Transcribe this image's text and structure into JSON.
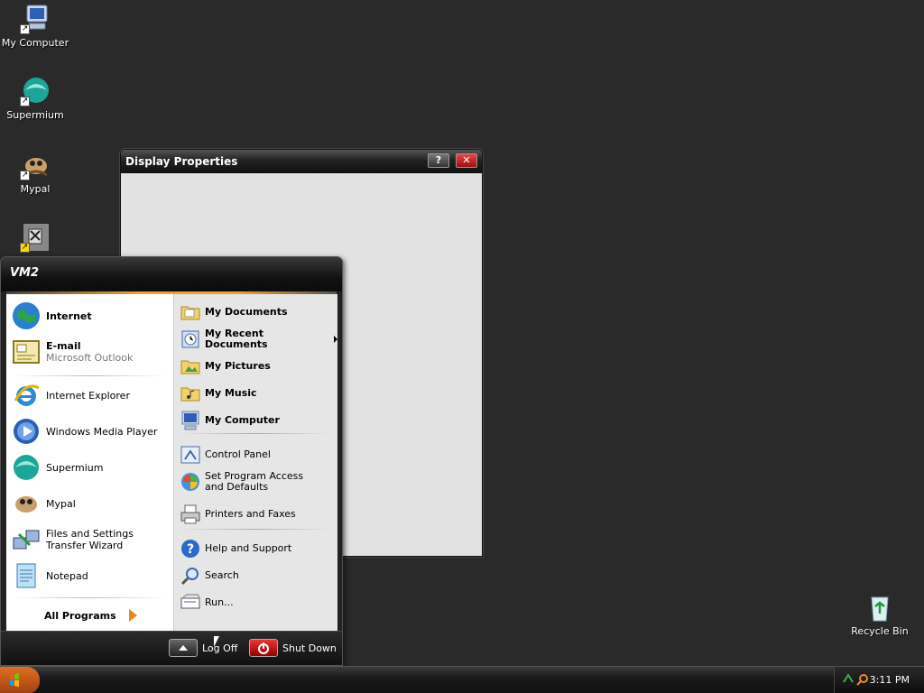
{
  "desktop": {
    "icons": [
      {
        "label": "My Computer"
      },
      {
        "label": "Supermium"
      },
      {
        "label": "Mypal"
      },
      {
        "label": ""
      },
      {
        "label": "Recycle Bin"
      }
    ]
  },
  "window": {
    "title": "Display Properties",
    "help_label": "?",
    "close_label": "✕"
  },
  "start_menu": {
    "user": "VM2",
    "pinned": [
      {
        "title": "Internet",
        "subtitle": ""
      },
      {
        "title": "E-mail",
        "subtitle": "Microsoft Outlook"
      }
    ],
    "recent": [
      {
        "label": "Internet Explorer"
      },
      {
        "label": "Windows Media Player"
      },
      {
        "label": "Supermium"
      },
      {
        "label": "Mypal"
      },
      {
        "label": "Files and Settings Transfer Wizard"
      },
      {
        "label": "Notepad"
      }
    ],
    "all_programs": "All Programs",
    "places": [
      {
        "label": "My Documents"
      },
      {
        "label": "My Recent Documents"
      },
      {
        "label": "My Pictures"
      },
      {
        "label": "My Music"
      },
      {
        "label": "My Computer"
      }
    ],
    "system": [
      {
        "label": "Control Panel"
      },
      {
        "label": "Set Program Access and Defaults"
      },
      {
        "label": "Printers and Faxes"
      }
    ],
    "tools": [
      {
        "label": "Help and Support"
      },
      {
        "label": "Search"
      },
      {
        "label": "Run..."
      }
    ],
    "log_off": "Log Off",
    "shut_down": "Shut Down"
  },
  "taskbar": {
    "clock": "3:11 PM"
  },
  "colors": {
    "desktop_bg": "#2a2a2a",
    "accent_orange": "#f0a030",
    "close_red": "#cc2222"
  }
}
